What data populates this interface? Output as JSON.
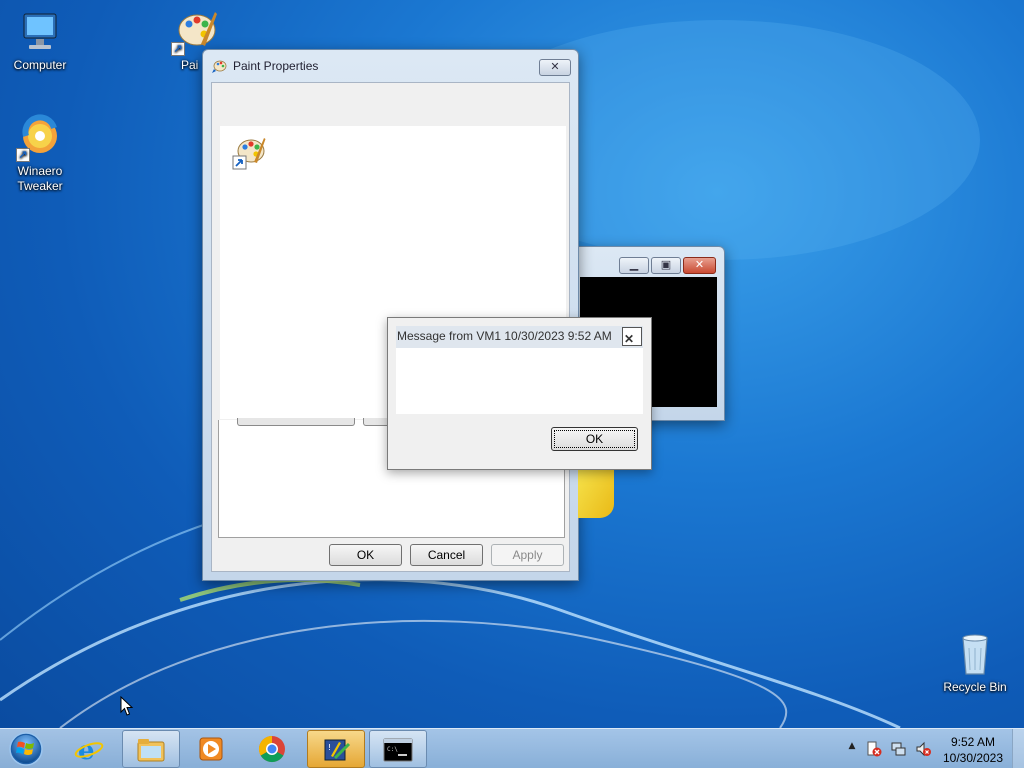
{
  "desktop": {
    "icons": [
      {
        "label": "Computer",
        "icon": "computer-icon"
      },
      {
        "label": "Pai",
        "icon": "paint-icon"
      },
      {
        "label": "Winaero Tweaker",
        "icon": "winaero-tweaker-icon"
      },
      {
        "label": "Recycle Bin",
        "icon": "recycle-bin-icon"
      }
    ]
  },
  "paint_properties": {
    "title": "Paint Properties",
    "buttons": {
      "ok": "OK",
      "cancel": "Cancel",
      "apply": "Apply"
    }
  },
  "message_box": {
    "title": "Message from VM1 10/30/2023 9:52 AM",
    "close_glyph": "✕",
    "ok_label": "OK"
  },
  "taskbar": {
    "items": [
      {
        "icon": "internet-explorer-icon"
      },
      {
        "icon": "file-explorer-icon"
      },
      {
        "icon": "media-player-icon"
      },
      {
        "icon": "chrome-icon"
      },
      {
        "icon": "paint-icon"
      },
      {
        "icon": "command-prompt-icon"
      }
    ],
    "clock": {
      "time": "9:52 AM",
      "date": "10/30/2023"
    },
    "tray_arrow": "▲"
  },
  "colors": {
    "accent": "#1b78d2",
    "taskbar_highlight": "#e5a735"
  }
}
